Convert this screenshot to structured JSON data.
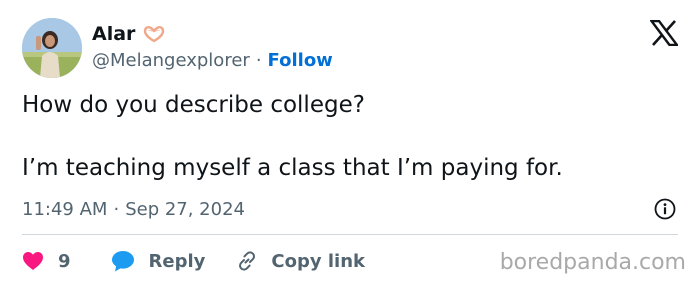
{
  "author": {
    "display_name": "Alar",
    "name_emoji": "heart-hands-emoji",
    "handle": "@Melangexplorer",
    "separator": "·",
    "follow_label": "Follow"
  },
  "tweet": {
    "line1": "How do you describe college?",
    "line2": "I’m teaching myself a class that I’m paying for."
  },
  "meta": {
    "time": "11:49 AM",
    "separator": "·",
    "date": "Sep 27, 2024"
  },
  "actions": {
    "like_count": "9",
    "reply_label": "Reply",
    "copy_label": "Copy link"
  },
  "watermark": "boredpanda.com",
  "colors": {
    "link": "#006fd6",
    "like": "#f91880",
    "reply": "#1d9bf0",
    "muted": "#536471",
    "text": "#0f1419"
  },
  "icons": {
    "brand": "x-logo-icon",
    "info": "info-icon",
    "like": "heart-icon",
    "reply": "speech-bubble-icon",
    "copy": "link-icon"
  }
}
